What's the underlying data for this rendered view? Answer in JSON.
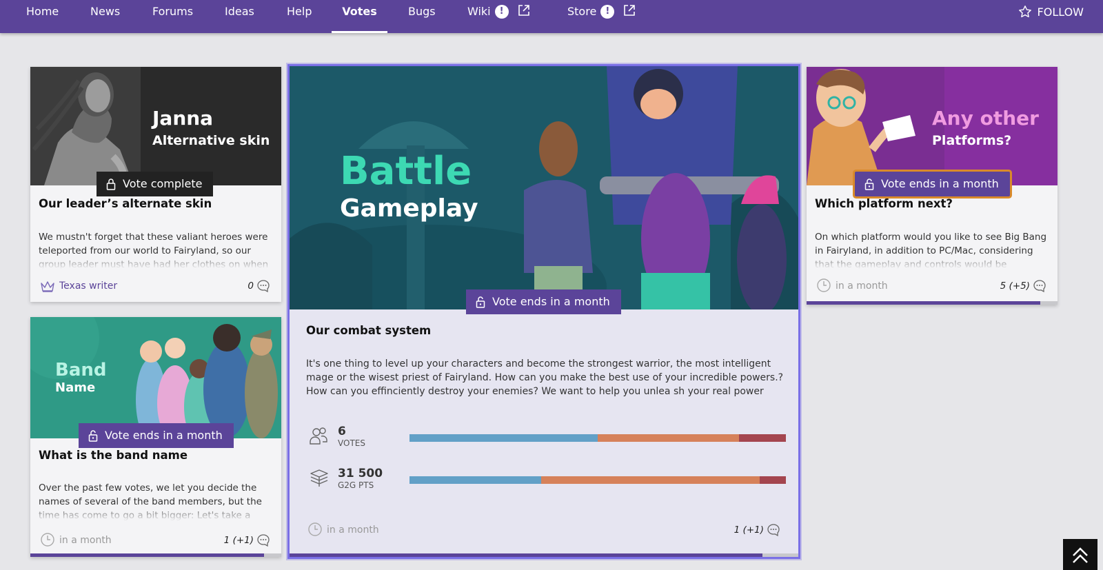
{
  "nav": {
    "items": [
      {
        "label": "Home"
      },
      {
        "label": "News"
      },
      {
        "label": "Forums"
      },
      {
        "label": "Ideas"
      },
      {
        "label": "Help"
      },
      {
        "label": "Votes",
        "active": true
      },
      {
        "label": "Bugs"
      },
      {
        "label": "Wiki",
        "alert": "!",
        "external": true
      },
      {
        "label": "Store",
        "alert": "!",
        "external": true
      }
    ],
    "follow_label": "FOLLOW"
  },
  "cards": [
    {
      "image_title": "Janna",
      "image_subtitle": "Alternative skin",
      "badge": "Vote complete",
      "badge_icon": "lock-icon",
      "title": "Our leader’s alternate skin",
      "description": "We mustn't forget that these valiant heroes were teleported from our world to Fairyland, so our group leader must have had her clothes on when",
      "footer": "Texas writer",
      "footer_icon": "crown-icon",
      "count": "0",
      "progress": 0
    },
    {
      "image_title": "Band",
      "image_subtitle": "Name",
      "badge": "Vote ends in a month",
      "badge_icon": "unlock-icon",
      "title": "What is the band name",
      "description": "Over the past few votes, we let you decide the names of several of the band members, but the time has come to go a bit bigger: Let's take a look",
      "footer": "in a month",
      "footer_icon": "clock-icon",
      "count": "1 (+1)",
      "progress": 0.93
    },
    {
      "image_title": "Battle",
      "image_subtitle": "Gameplay",
      "badge": "Vote ends in a month",
      "badge_icon": "unlock-icon",
      "title": "Our combat system",
      "description": "It's one thing to level up your characters and become the strongest warrior, the most intelligent mage or the wisest priest of Fairyland. How can you make the best use of your incredible powers.? How can you effinciently destroy your enemies? We want to help you unlea sh your real power through the best",
      "stats": [
        {
          "value": "6",
          "label": "VOTES",
          "icon": "users-icon",
          "segments": [
            0.5,
            0.375,
            0.125
          ]
        },
        {
          "value": "31 500",
          "label": "G2G PTS",
          "icon": "coins-icon",
          "segments": [
            0.35,
            0.58,
            0.07
          ]
        }
      ],
      "segment_colors": [
        "#62a0c7",
        "#d6815a",
        "#a4454f"
      ],
      "footer": "in a month",
      "footer_icon": "clock-icon",
      "count": "1 (+1)",
      "progress": 0.93
    },
    {
      "image_title": "Any other",
      "image_subtitle": "Platforms?",
      "badge": "Vote ends in a month",
      "badge_icon": "unlock-icon",
      "title": "Which platform next?",
      "description": "On which platform would you like to see Big Bang in Fairyland, in addition to PC/Mac, considering that the gameplay and controls would be reworked",
      "footer": "in a month",
      "footer_icon": "clock-icon",
      "count": "5 (+5)",
      "progress": 0.93
    }
  ],
  "colors": {
    "brand": "#5b4499",
    "highlight": "#7a6fe6",
    "focus_outline": "#d98a2b"
  }
}
